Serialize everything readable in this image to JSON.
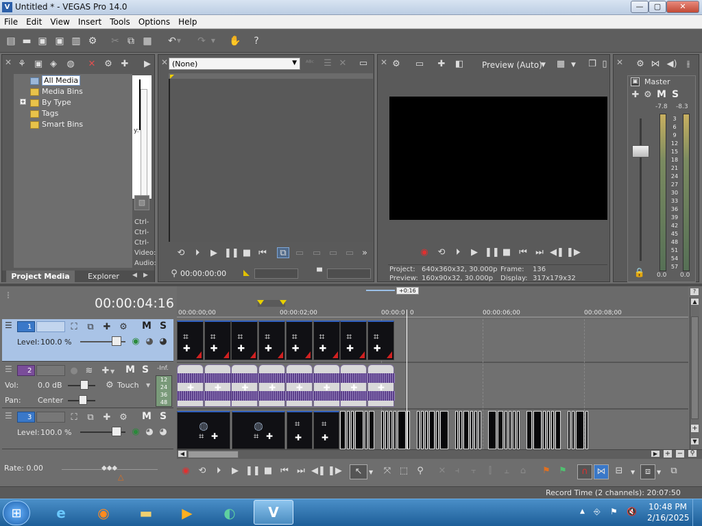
{
  "window": {
    "title": "Untitled * - VEGAS Pro 14.0",
    "app_icon": "V",
    "min": "—",
    "max": "▢",
    "close": "✕"
  },
  "menu": [
    "File",
    "Edit",
    "View",
    "Insert",
    "Tools",
    "Options",
    "Help"
  ],
  "media": {
    "tree": [
      "All Media",
      "Media Bins",
      "By Type",
      "Tags",
      "Smart Bins"
    ],
    "expand": "+",
    "tabs": [
      "Project Media",
      "Explorer"
    ],
    "side_labels": [
      "Ctrl-",
      "Ctrl-",
      "Ctrl-",
      "Video:",
      "Audio:"
    ],
    "side_y": "y:"
  },
  "trimmer": {
    "select_value": "(None)",
    "timecode": "00:00:00:00"
  },
  "preview": {
    "mode": "Preview (Auto)",
    "project_label": "Project:",
    "project_value": "640x360x32, 30.000p",
    "preview_label": "Preview:",
    "preview_value": "160x90x32, 30.000p",
    "frame_label": "Frame:",
    "frame_value": "136",
    "display_label": "Display:",
    "display_value": "317x179x32"
  },
  "master": {
    "title": "Master",
    "m": "M",
    "s": "S",
    "peak_left": "-7.8",
    "peak_right": "-8.3",
    "scale": [
      "3",
      "6",
      "9",
      "12",
      "15",
      "18",
      "21",
      "24",
      "27",
      "30",
      "33",
      "36",
      "39",
      "42",
      "45",
      "48",
      "51",
      "54",
      "57"
    ],
    "bottom_left": "0.0",
    "bottom_right": "0.0",
    "fader_level": 0.77
  },
  "timeline": {
    "timecode": "00:00:04:16",
    "cursor_tag": "+0:16",
    "ruler": [
      "00:00:00;00",
      "00:00:02;00",
      "00:00:0",
      "0",
      "00:00:06;00",
      "00:00:08;00"
    ],
    "tracks": [
      {
        "num": "1",
        "level_label": "Level:",
        "level_value": "100.0 %",
        "m": "M",
        "s": "S"
      },
      {
        "num": "2",
        "vol_label": "Vol:",
        "vol_value": "0.0 dB",
        "pan_label": "Pan:",
        "pan_value": "Center",
        "automation": "Touch",
        "inf": "-Inf.",
        "meter": [
          "12",
          "24",
          "36",
          "48"
        ],
        "m": "M",
        "s": "S"
      },
      {
        "num": "3",
        "level_label": "Level:",
        "level_value": "100.0 %",
        "m": "M",
        "s": "S"
      }
    ],
    "rate_label": "Rate: 0.00",
    "status": "Record Time (2 channels): 20:07:50"
  },
  "taskbar": {
    "time": "10:48 PM",
    "date": "2/16/2025"
  },
  "colors": {
    "track1": "#a9c3e6",
    "accent": "#3a78c8",
    "record": "#e03030"
  }
}
